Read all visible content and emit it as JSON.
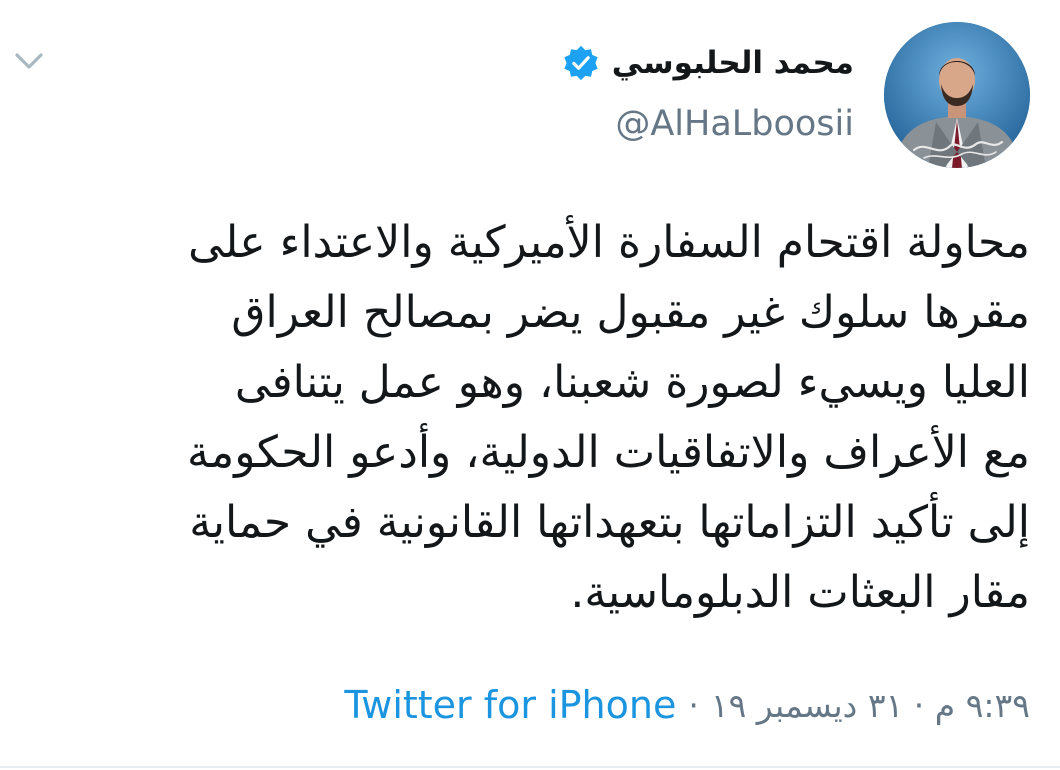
{
  "author": {
    "display_name": "محمد الحلبوسي",
    "handle": "@AlHaLboosii",
    "verified": true,
    "avatar_icon": "profile-photo-avatar"
  },
  "tweet": {
    "lines": [
      "محاولة اقتحام السفارة الأميركية والاعتداء على",
      "مقرها سلوك غير مقبول يضر بمصالح العراق",
      "العليا ويسيء لصورة شعبنا، وهو عمل يتنافى",
      "مع الأعراف والاتفاقيات الدولية، وأدعو الحكومة",
      "إلى تأكيد التزاماتها بتعهداتها القانونية في حماية",
      "مقار البعثات الدبلوماسية."
    ],
    "timestamp": "٩:٣٩ م · ٣١ ديسمبر ١٩",
    "separator": "·",
    "source": "Twitter for iPhone"
  },
  "icons": {
    "menu": "chevron-down-icon",
    "verified": "verified-badge-icon"
  },
  "colors": {
    "text": "#14171a",
    "secondary": "#657786",
    "link": "#1b95e0",
    "verified_badge": "#1da1f2",
    "divider": "#e6ecf0"
  }
}
